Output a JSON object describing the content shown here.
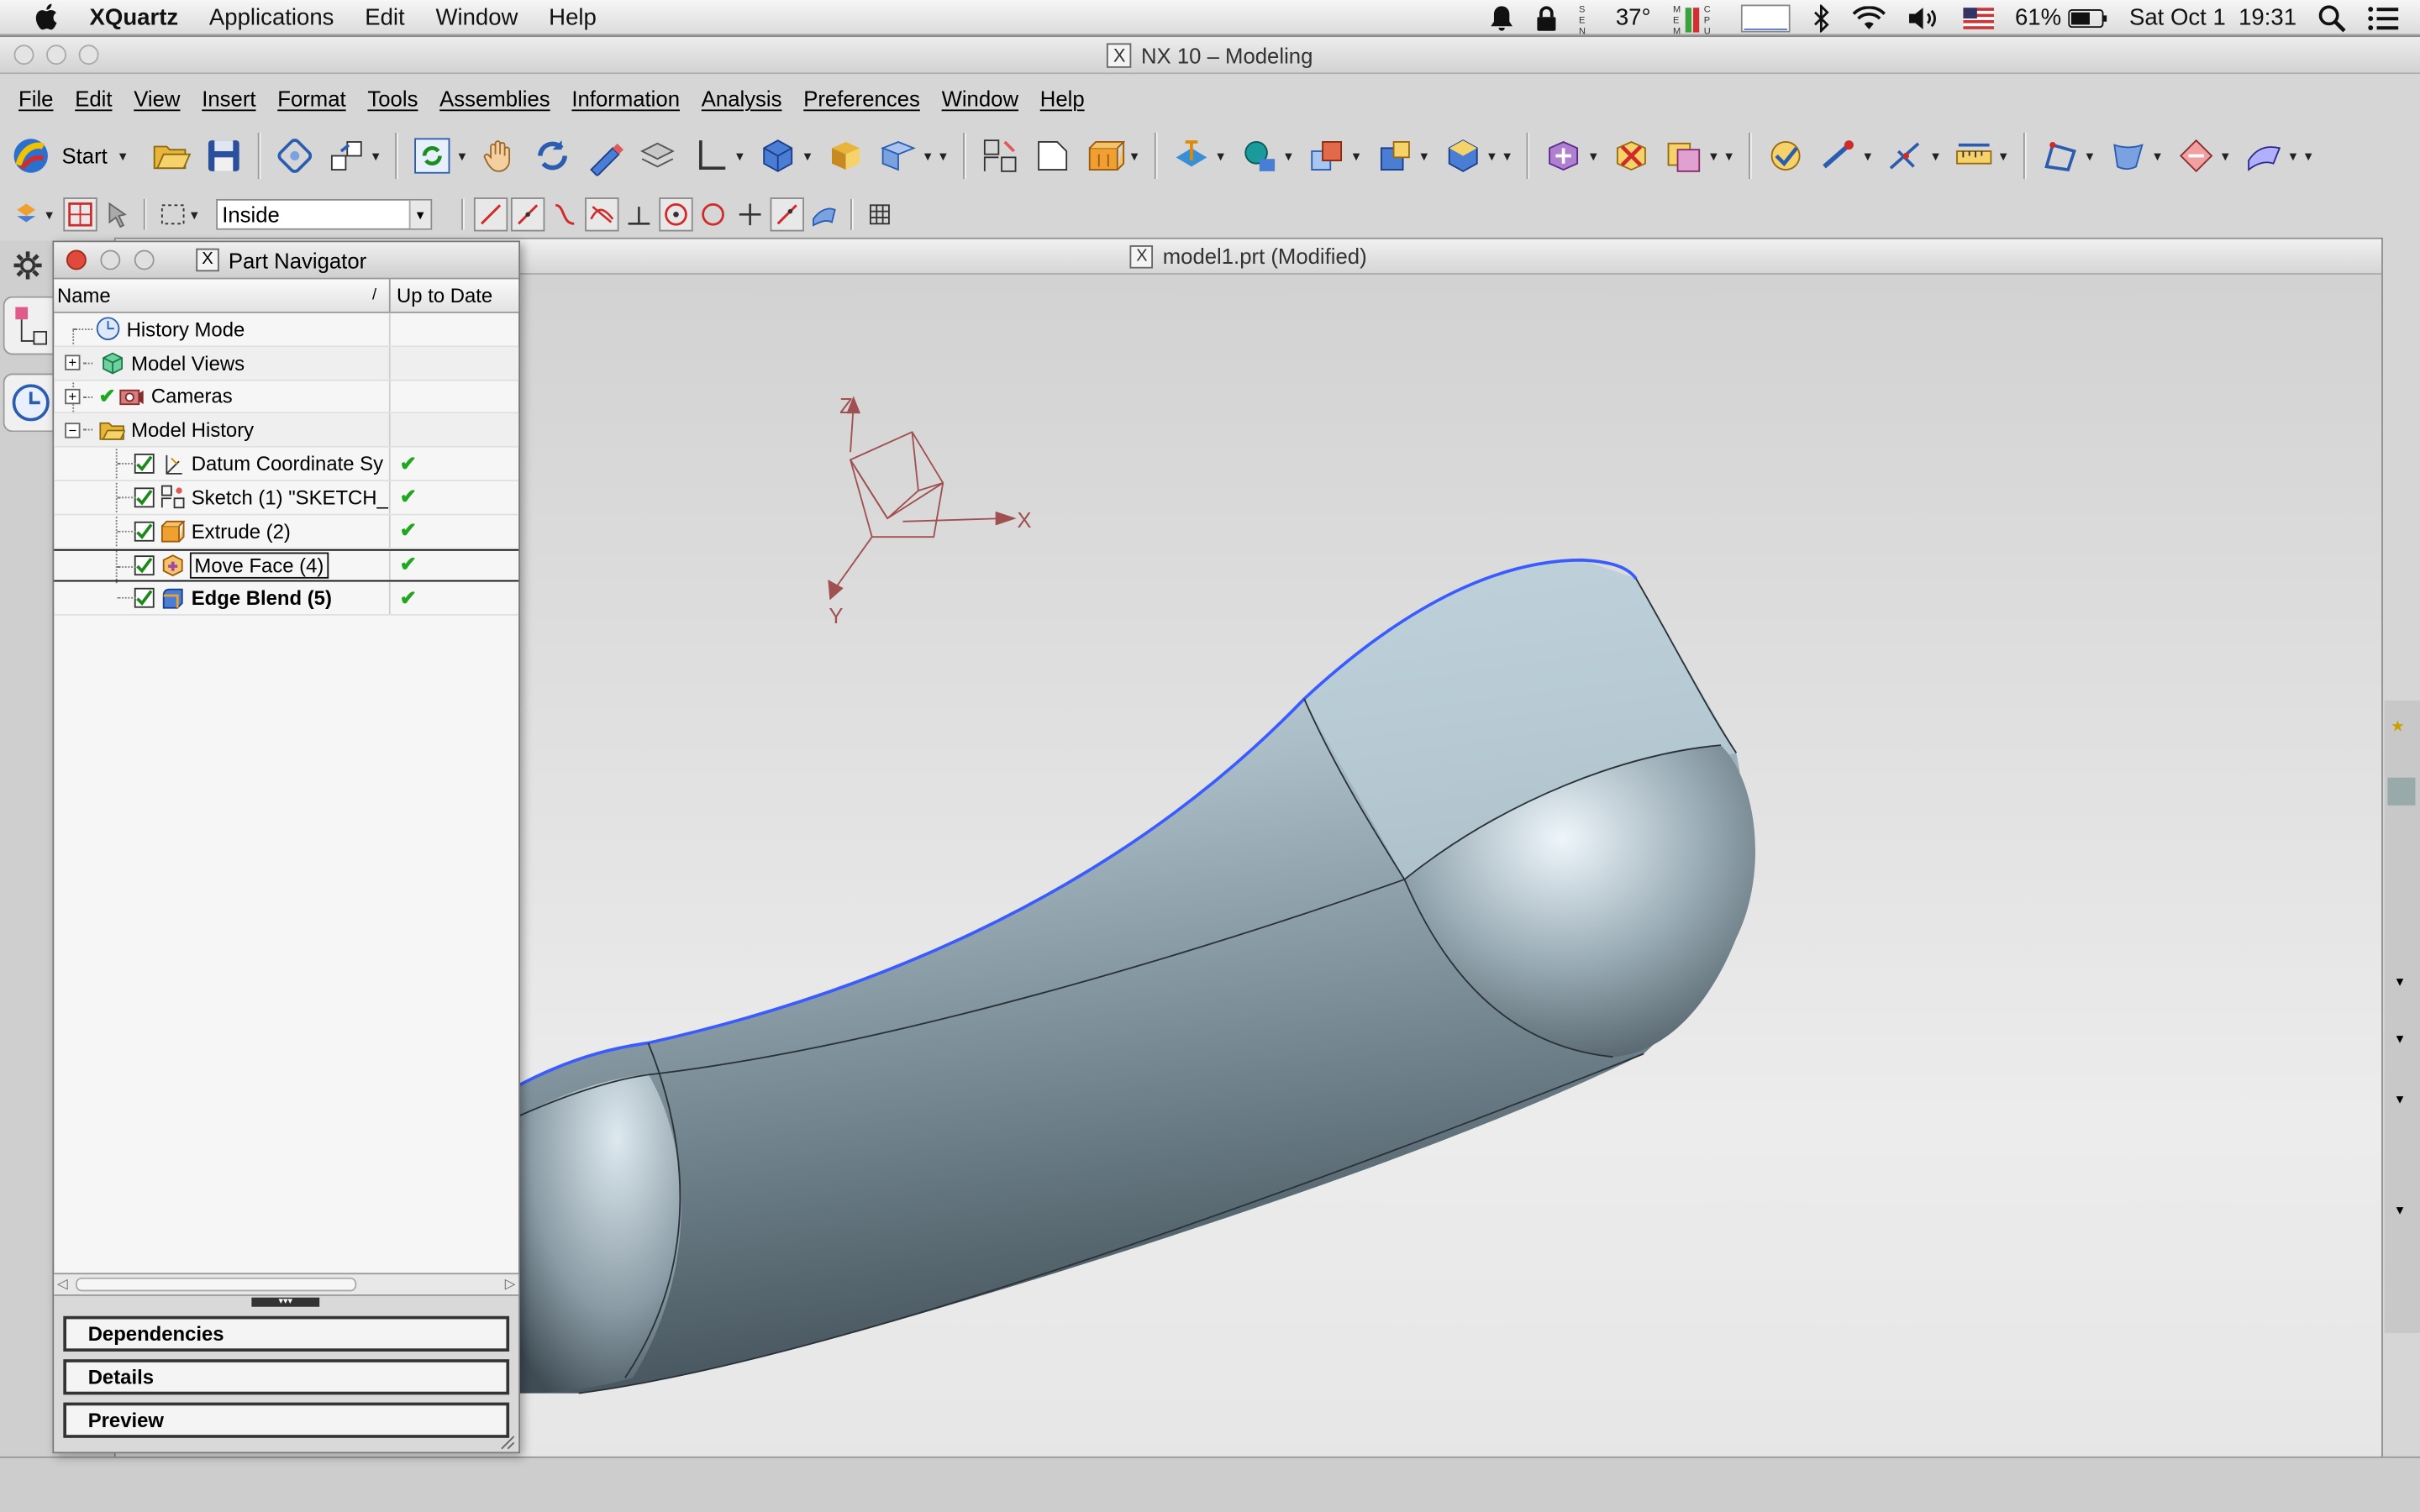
{
  "os_menu": {
    "app": "XQuartz",
    "items": [
      "Applications",
      "Edit",
      "Window",
      "Help"
    ]
  },
  "status": {
    "temperature": "37°",
    "battery": "61%",
    "clock": "Sat Oct 1  19:31"
  },
  "window": {
    "title": "NX 10 – Modeling"
  },
  "menu": [
    "File",
    "Edit",
    "View",
    "Insert",
    "Format",
    "Tools",
    "Assemblies",
    "Information",
    "Analysis",
    "Preferences",
    "Window",
    "Help"
  ],
  "toolbar": {
    "start_label": "Start",
    "filter_value": "Inside"
  },
  "graphics": {
    "title": "model1.prt (Modified)",
    "axis_x": "X",
    "axis_y": "Y",
    "axis_z": "Z"
  },
  "part_navigator": {
    "title": "Part Navigator",
    "col_name": "Name",
    "col_uptodate": "Up to Date",
    "rows": [
      {
        "label": "History Mode"
      },
      {
        "label": "Model Views"
      },
      {
        "label": "Cameras"
      },
      {
        "label": "Model History"
      },
      {
        "label": "Datum Coordinate Sy"
      },
      {
        "label": "Sketch (1) \"SKETCH_"
      },
      {
        "label": "Extrude (2)"
      },
      {
        "label": "Move Face (4)"
      },
      {
        "label": "Edge Blend (5)"
      }
    ],
    "panels": [
      "Dependencies",
      "Details",
      "Preview"
    ]
  },
  "colors": {
    "accent_edge": "#3a5cff",
    "check_green": "#1fa81f"
  }
}
